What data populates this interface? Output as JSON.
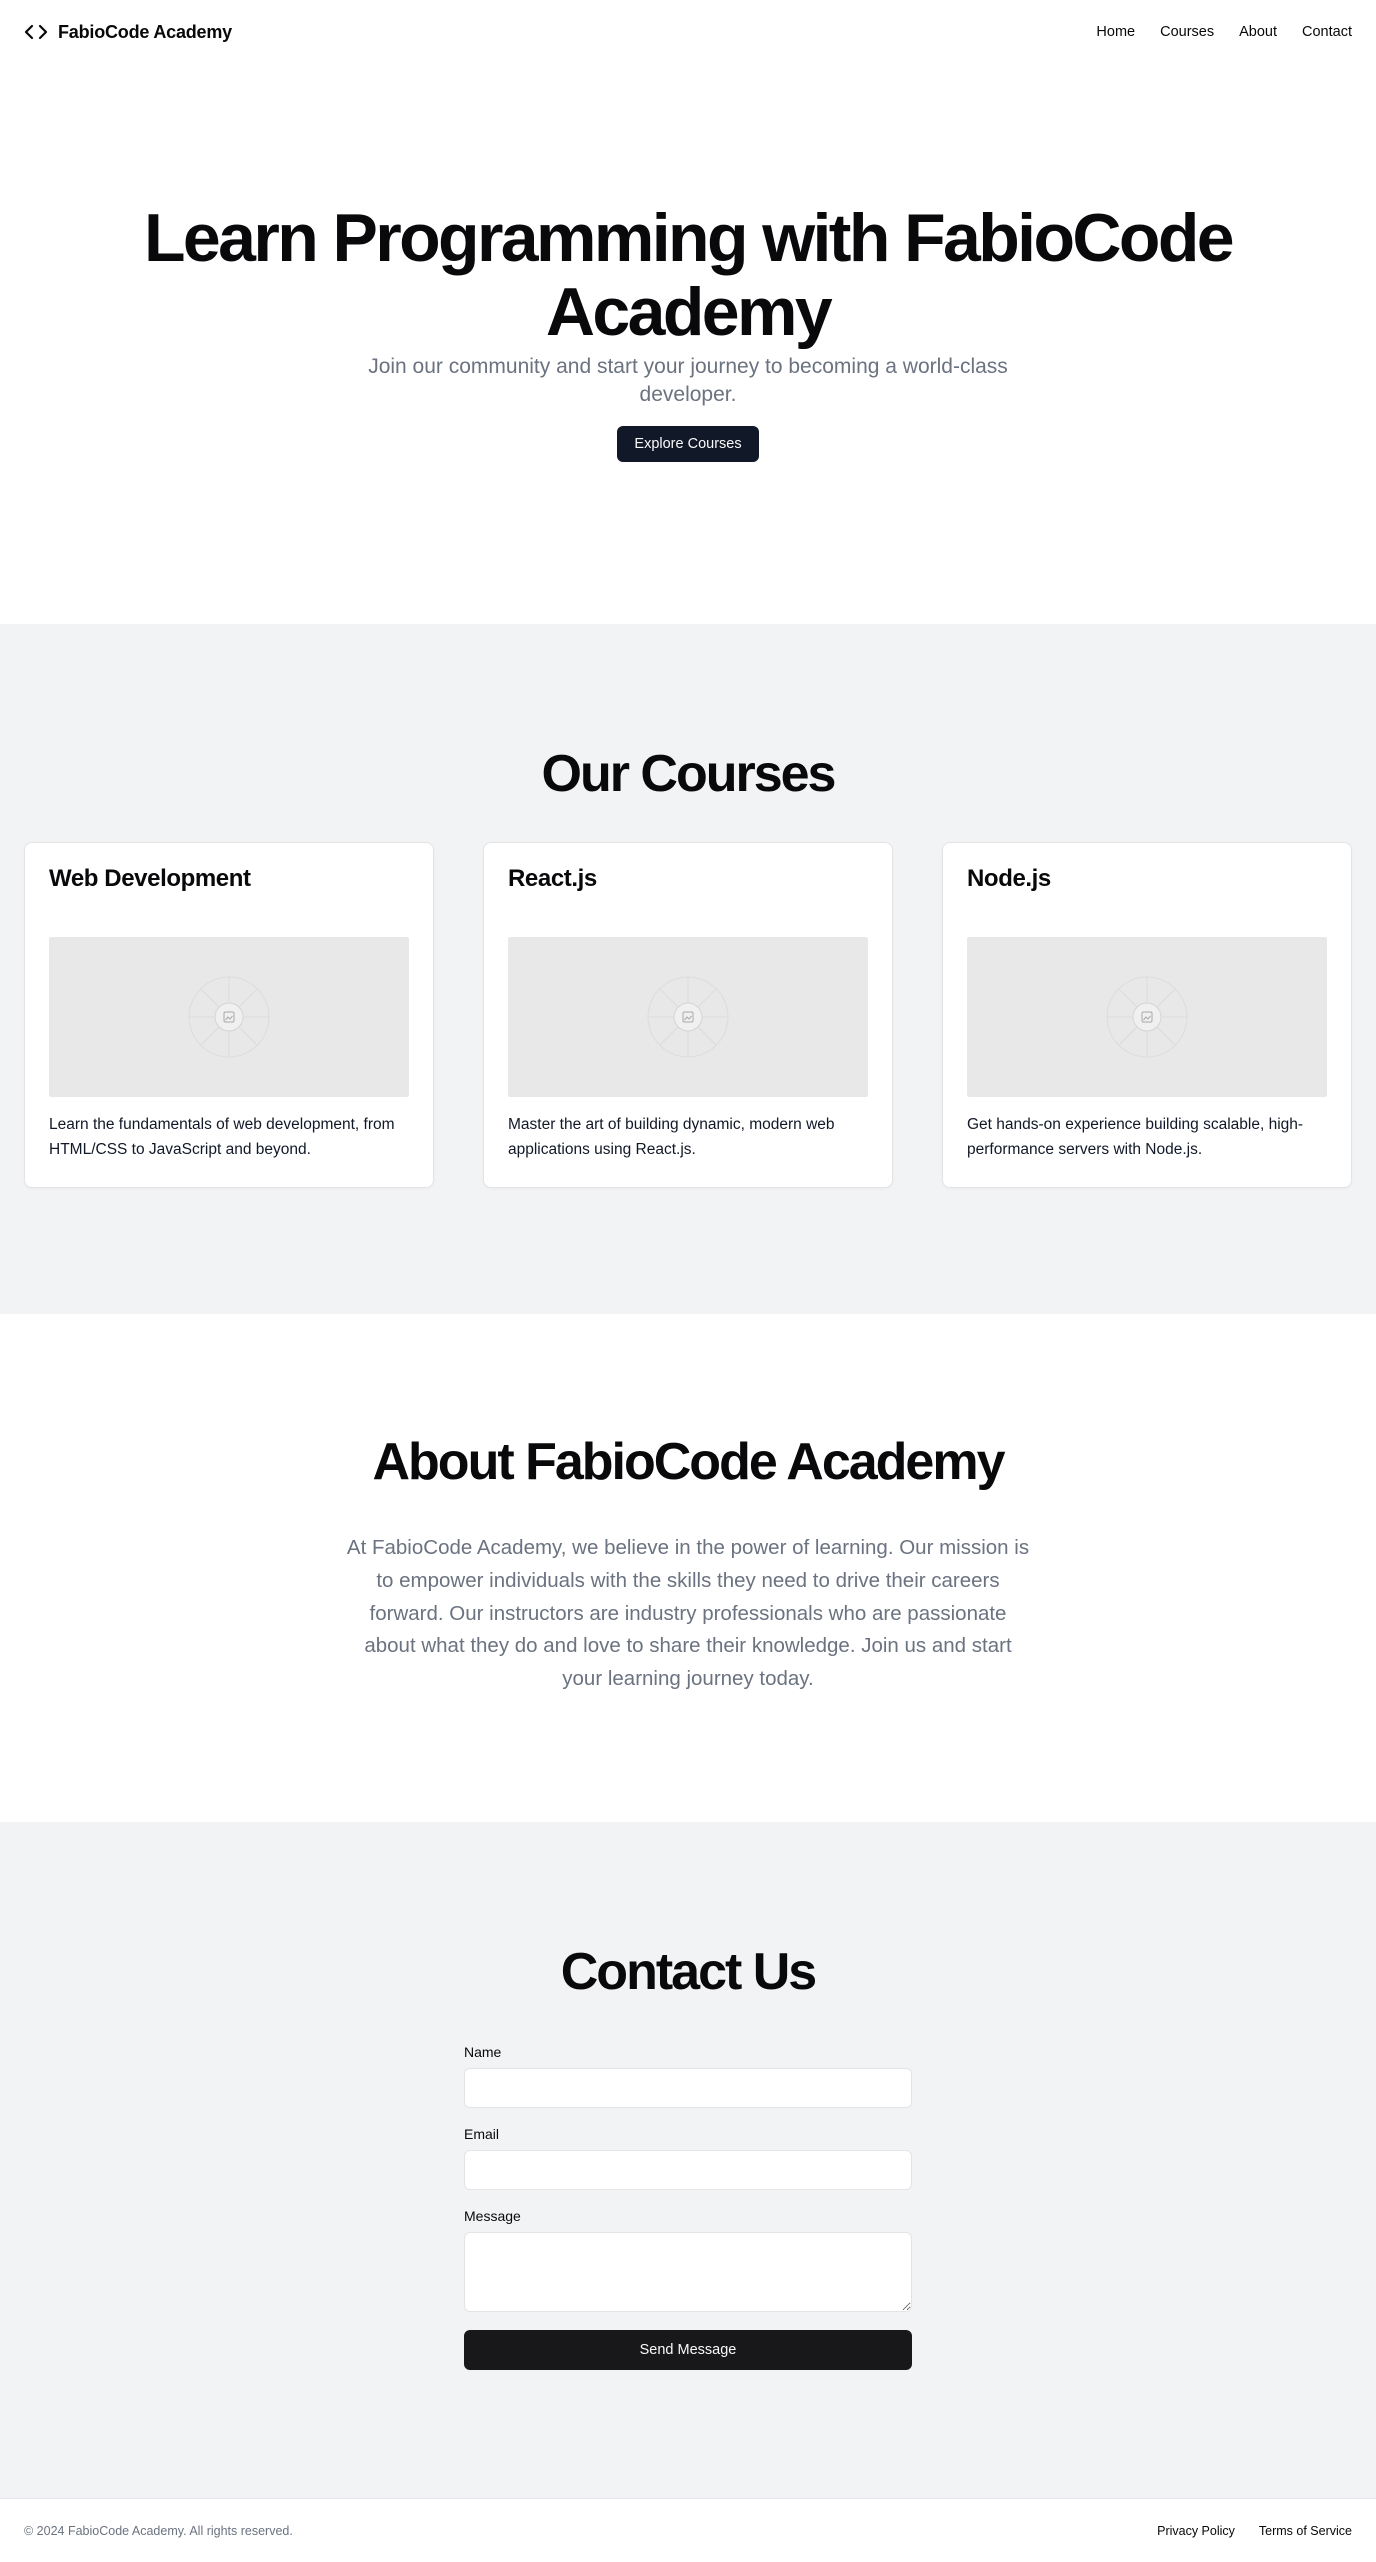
{
  "header": {
    "brand": "FabioCode Academy",
    "nav": [
      "Home",
      "Courses",
      "About",
      "Contact"
    ]
  },
  "hero": {
    "title": "Learn Programming with FabioCode Academy",
    "subtitle": "Join our community and start your journey to becoming a world-class developer.",
    "cta": "Explore Courses"
  },
  "courses": {
    "title": "Our Courses",
    "items": [
      {
        "title": "Web Development",
        "description": "Learn the fundamentals of web development, from HTML/CSS to JavaScript and beyond."
      },
      {
        "title": "React.js",
        "description": "Master the art of building dynamic, modern web applications using React.js."
      },
      {
        "title": "Node.js",
        "description": "Get hands-on experience building scalable, high-performance servers with Node.js."
      }
    ]
  },
  "about": {
    "title": "About FabioCode Academy",
    "text": "At FabioCode Academy, we believe in the power of learning. Our mission is to empower individuals with the skills they need to drive their careers forward. Our instructors are industry professionals who are passionate about what they do and love to share their knowledge. Join us and start your learning journey today."
  },
  "contact": {
    "title": "Contact Us",
    "name_label": "Name",
    "name_value": "",
    "email_label": "Email",
    "email_value": "",
    "message_label": "Message",
    "message_value": "",
    "submit": "Send Message"
  },
  "footer": {
    "copyright": "© 2024 FabioCode Academy. All rights reserved.",
    "links": [
      "Privacy Policy",
      "Terms of Service"
    ]
  },
  "icons": {
    "logo": "code-icon",
    "placeholder": "image-placeholder-icon"
  },
  "colors": {
    "primary_button": "#111827",
    "section_alt_bg": "#f2f3f5",
    "muted_text": "#6b7280"
  }
}
